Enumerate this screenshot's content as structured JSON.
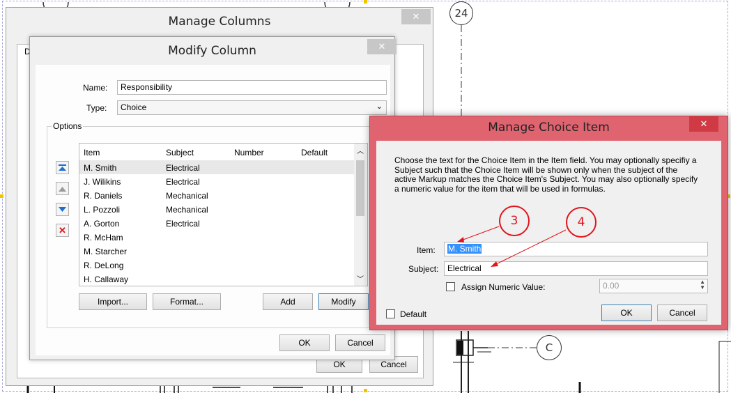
{
  "background": {
    "grid_bubbles": [
      "24",
      "C"
    ],
    "colors": {
      "cad_line": "#222222",
      "handle": "#f0c400"
    }
  },
  "manage_columns": {
    "title": "Manage Columns",
    "tab_fragment": "D",
    "ok_label": "OK",
    "cancel_label": "Cancel"
  },
  "modify_column": {
    "title": "Modify Column",
    "name_label": "Name:",
    "name_value": "Responsibility",
    "type_label": "Type:",
    "type_value": "Choice",
    "options_label": "Options",
    "columns": [
      "Item",
      "Subject",
      "Number",
      "Default"
    ],
    "rows": [
      {
        "item": "M. Smith",
        "subject": "Electrical"
      },
      {
        "item": "J. Wilikins",
        "subject": "Electrical"
      },
      {
        "item": "R. Daniels",
        "subject": "Mechanical"
      },
      {
        "item": "L. Pozzoli",
        "subject": "Mechanical"
      },
      {
        "item": "A. Gorton",
        "subject": "Electrical"
      },
      {
        "item": "R. McHam",
        "subject": ""
      },
      {
        "item": "M. Starcher",
        "subject": ""
      },
      {
        "item": "R. DeLong",
        "subject": ""
      },
      {
        "item": "H. Callaway",
        "subject": ""
      }
    ],
    "import_label": "Import...",
    "format_label": "Format...",
    "add_label": "Add",
    "modify_label": "Modify",
    "ok_label": "OK",
    "cancel_label": "Cancel"
  },
  "manage_choice_item": {
    "title": "Manage Choice Item",
    "description": "Choose the text for the Choice Item in the Item field. You may optionally specifiy a Subject such that the Choice Item will be shown only when the subject of the active Markup matches the Choice Item's Subject. You may also optionally specify a numeric value for the item that will be used in formulas.",
    "item_label": "Item:",
    "item_value": "M. Smith",
    "subject_label": "Subject:",
    "subject_value": "Electrical",
    "assign_numeric_label": "Assign Numeric Value:",
    "numeric_value": "0.00",
    "default_label": "Default",
    "ok_label": "OK",
    "cancel_label": "Cancel",
    "accent_color": "#e06470"
  },
  "annotations": [
    "3",
    "4"
  ]
}
